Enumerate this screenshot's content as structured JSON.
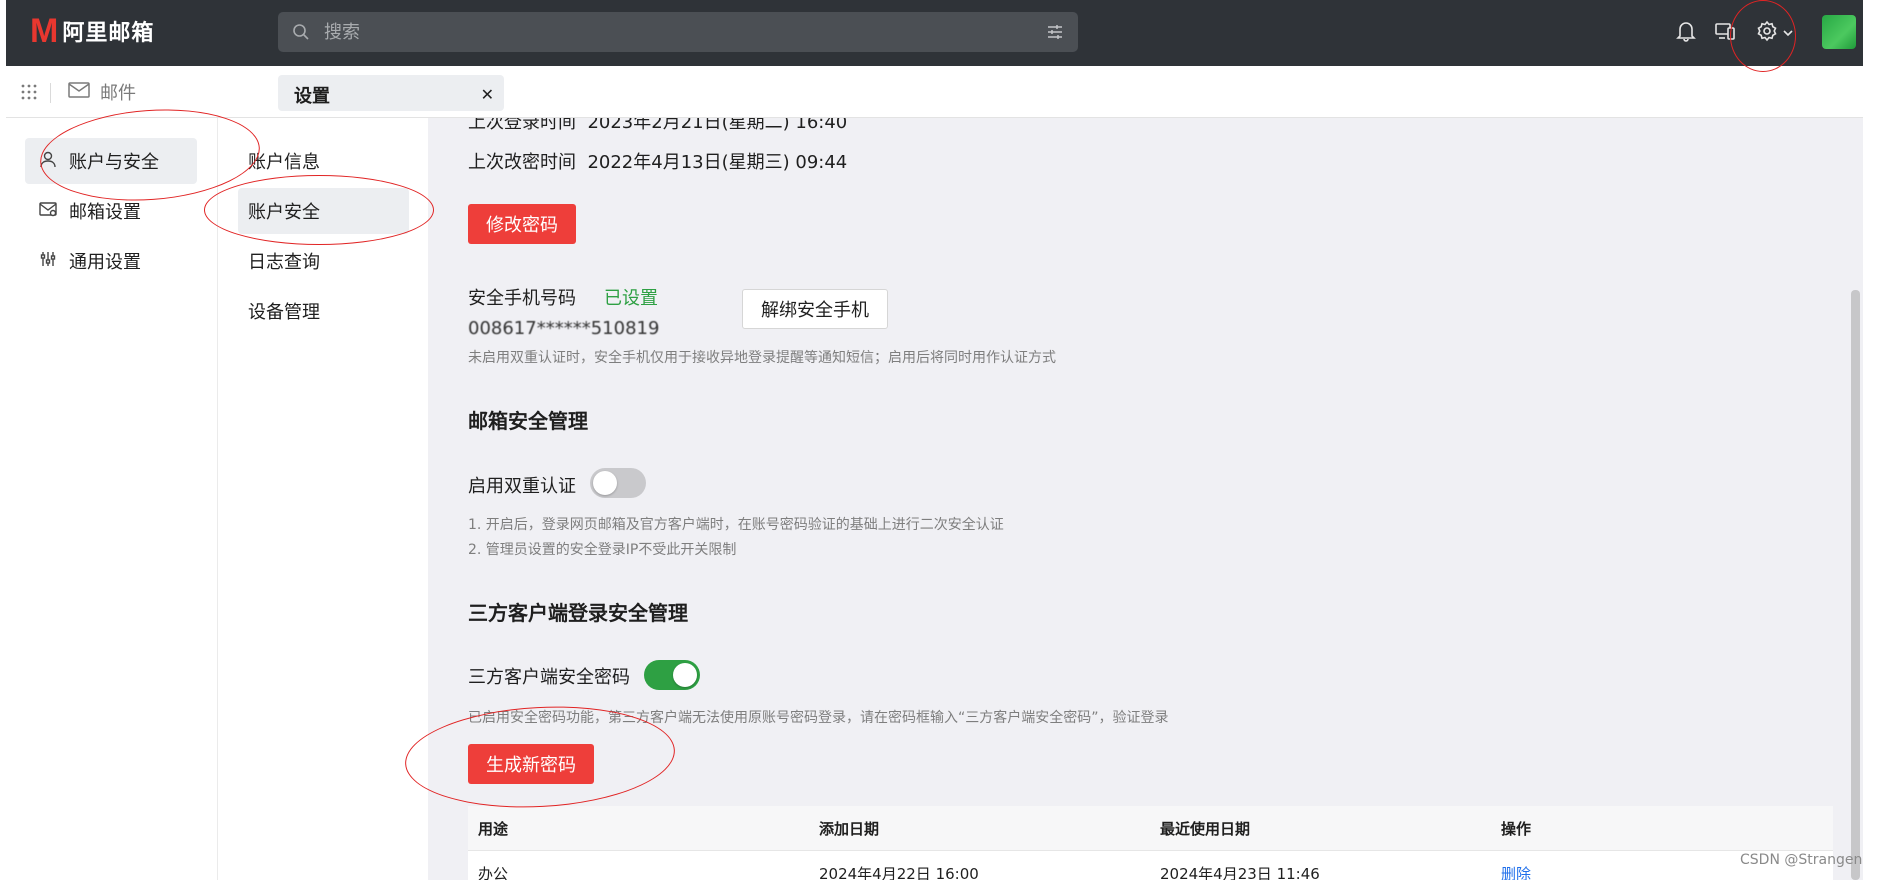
{
  "app": {
    "logo_mark": "M",
    "logo_text": "阿里邮箱"
  },
  "search": {
    "placeholder": "搜索"
  },
  "tabs": {
    "mail_label": "邮件",
    "settings_label": "设置",
    "close_symbol": "✕"
  },
  "nav1": {
    "items": [
      {
        "label": "账户与安全",
        "icon": "user-icon",
        "active": true
      },
      {
        "label": "邮箱设置",
        "icon": "mail-settings-icon",
        "active": false
      },
      {
        "label": "通用设置",
        "icon": "sliders-icon",
        "active": false
      }
    ]
  },
  "nav2": {
    "items": [
      {
        "label": "账户信息",
        "active": false
      },
      {
        "label": "账户安全",
        "active": true
      },
      {
        "label": "日志查询",
        "active": false
      },
      {
        "label": "设备管理",
        "active": false
      }
    ]
  },
  "account": {
    "last_login_label": "上次登录时间",
    "last_login_value": "2023年2月21日(星期二) 16:40",
    "last_change_label": "上次改密时间",
    "last_change_value": "2022年4月13日(星期三) 09:44",
    "change_password_button": "修改密码",
    "phone_label": "安全手机号码",
    "phone_status": "已设置",
    "phone_number": "008617******510819",
    "unbind_button": "解绑安全手机",
    "phone_hint": "未启用双重认证时，安全手机仅用于接收异地登录提醒等通知短信；启用后将同时用作认证方式"
  },
  "mailbox_security": {
    "title": "邮箱安全管理",
    "two_factor_label": "启用双重认证",
    "two_factor_enabled": false,
    "note1": "1. 开启后，登录网页邮箱及官方客户端时，在账号密码验证的基础上进行二次安全认证",
    "note2": "2. 管理员设置的安全登录IP不受此开关限制"
  },
  "third_party": {
    "title": "三方客户端登录安全管理",
    "password_label": "三方客户端安全密码",
    "password_enabled": true,
    "hint": "已启用安全密码功能，第三方客户端无法使用原账号密码登录，请在密码框输入“三方客户端安全密码”，验证登录",
    "generate_button": "生成新密码"
  },
  "table": {
    "headers": [
      "用途",
      "添加日期",
      "最近使用日期",
      "操作"
    ],
    "rows": [
      {
        "purpose": "办公",
        "added": "2024年4月22日 16:00",
        "last_used": "2024年4月23日 11:46",
        "action": "删除"
      }
    ]
  },
  "watermark": "CSDN @Strangen",
  "colors": {
    "topbar": "#2f3338",
    "brand_red": "#e8372f",
    "button_red": "#ee3e3a",
    "status_green": "#2ea043",
    "link_blue": "#1f6feb",
    "annotation_red": "#e12424"
  }
}
